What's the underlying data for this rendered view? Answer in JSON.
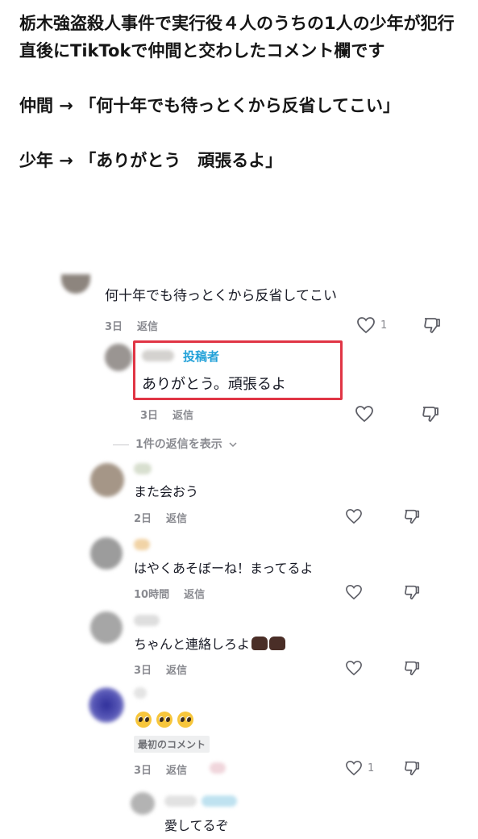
{
  "article": {
    "para1": "栃木強盗殺人事件で実行役４人のうちの1人の少年が犯行直後にTikTokで仲間と交わしたコメント欄です",
    "para2": "仲間 → 「何十年でも待っとくから反省してこい」",
    "para3": "少年 → 「ありがとう　頑張るよ」"
  },
  "comments": [
    {
      "text": "何十年でも待っとくから反省してこい",
      "time": "3日",
      "reply": "返信",
      "likes": "1"
    },
    {
      "tag": "投稿者",
      "text": "ありがとう。頑張るよ",
      "time": "3日",
      "reply": "返信"
    },
    {
      "show_replies": "1件の返信を表示"
    },
    {
      "text": "また会おう",
      "time": "2日",
      "reply": "返信"
    },
    {
      "text": "はやくあそぼーね！まってるよ",
      "time": "10時間",
      "reply": "返信"
    },
    {
      "text": "ちゃんと連絡しろよ",
      "time": "3日",
      "reply": "返信"
    },
    {
      "badge": "最初のコメント",
      "time": "3日",
      "reply": "返信",
      "likes": "1"
    },
    {
      "text": "愛してるぞ"
    }
  ],
  "colors": {
    "author_tag": "#22a1d8",
    "highlight_border": "#e03545",
    "meta": "#8a8b91"
  },
  "icons": [
    "heart-icon",
    "thumbs-down-icon",
    "chevron-down-icon",
    "pleading-face-emoji",
    "fist-emoji"
  ]
}
